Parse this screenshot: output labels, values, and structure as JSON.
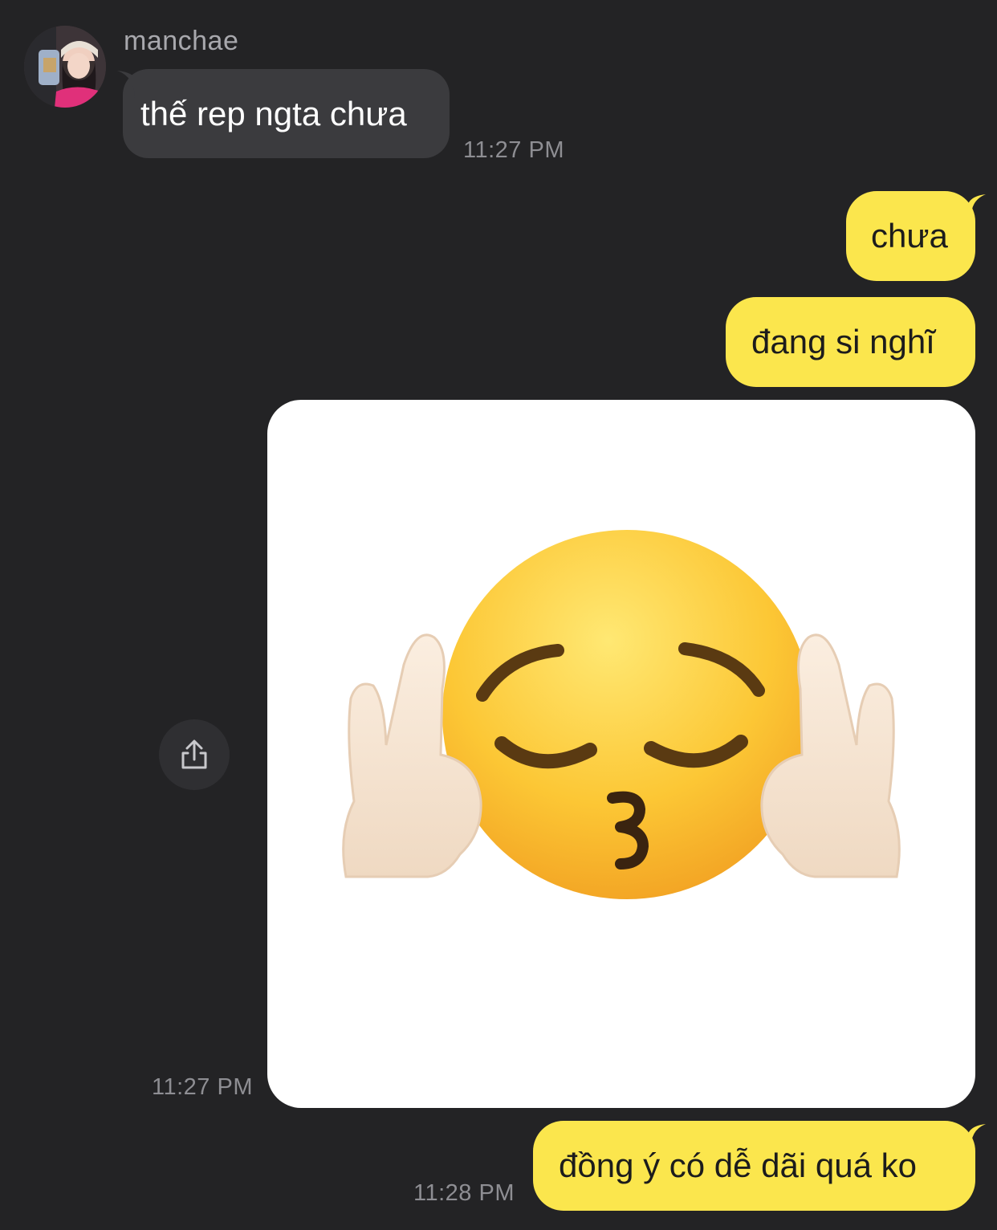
{
  "contact": {
    "name": "manchae",
    "avatar_icon": "profile-photo"
  },
  "messages": [
    {
      "id": "m1",
      "direction": "incoming",
      "text": "thế rep ngta chưa",
      "time": "11:27 PM"
    },
    {
      "id": "m2",
      "direction": "outgoing",
      "text": "chưa"
    },
    {
      "id": "m3",
      "direction": "outgoing",
      "text": "đang si nghĩ"
    },
    {
      "id": "m4",
      "direction": "outgoing",
      "type": "image",
      "image_icon": "kissing-face-middle-fingers-emoji",
      "time": "11:27 PM"
    },
    {
      "id": "m5",
      "direction": "outgoing",
      "text": "đồng ý có dễ dãi quá ko",
      "time": "11:28 PM"
    }
  ],
  "share_button": {
    "icon": "share-icon"
  },
  "colors": {
    "background": "#232325",
    "incoming_bubble": "#3b3b3e",
    "outgoing_bubble": "#fbe64d",
    "timestamp": "#8e8e93"
  }
}
